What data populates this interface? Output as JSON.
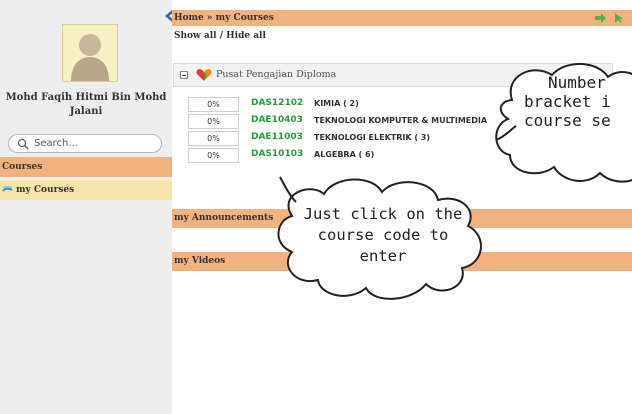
{
  "sidebar": {
    "user_name": "Mohd Faqih Hitmi Bin Mohd Jalani",
    "search_placeholder": "Search...",
    "courses_header": "Courses",
    "my_courses": "my Courses"
  },
  "breadcrumb": {
    "text": "Home » my Courses"
  },
  "toolbar": {
    "show_hide": "Show all / Hide all"
  },
  "category": {
    "label": "Pusat Pengajian Diploma"
  },
  "courses": [
    {
      "progress": "0%",
      "code": "DAS12102",
      "name": "KIMIA ( 2)"
    },
    {
      "progress": "0%",
      "code": "DAE10403",
      "name": "TEKNOLOGI KOMPUTER & MULTIMEDIA"
    },
    {
      "progress": "0%",
      "code": "DAE11003",
      "name": "TEKNOLOGI ELEKTRIK ( 3)"
    },
    {
      "progress": "0%",
      "code": "DAS10103",
      "name": "ALGEBRA ( 6)"
    }
  ],
  "sections": {
    "announcements": "my Announcements",
    "videos": "my Videos"
  },
  "callouts": {
    "top_right_line1": "Number",
    "top_right_line2": "bracket i",
    "top_right_line3": "course se",
    "bottom_line1": "Just click on the",
    "bottom_line2": "course code to",
    "bottom_line3": "enter"
  },
  "colors": {
    "header_orange": "#f0b27e",
    "highlight_yellow": "#f7e4a8",
    "course_code_green": "#2a9a3a",
    "sidebar_gray": "#eeeeee"
  },
  "icons": {
    "collapse": "chevron-left-icon",
    "avatar": "user-silhouette-icon",
    "search": "magnifier-icon",
    "courses_link": "courses-icon",
    "category": "colorful-category-icon",
    "breadcrumb_right": [
      "green-arrow-icon",
      "cursor-arrow-icon"
    ]
  }
}
